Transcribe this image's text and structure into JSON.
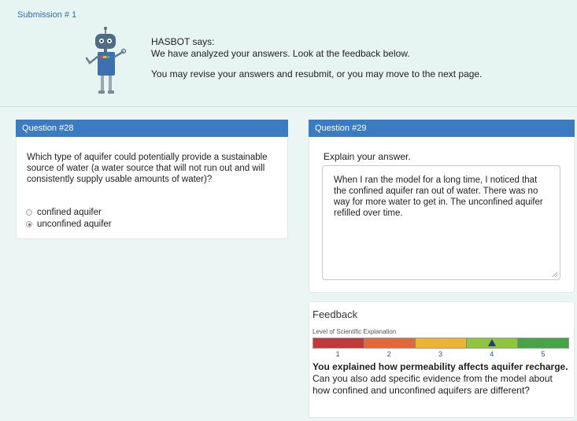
{
  "submission": {
    "label": "Submission # 1"
  },
  "bot": {
    "name": "HASBOT says:",
    "message_1": "We have analyzed your answers. Look at the feedback below.",
    "message_2": "You may revise your answers and resubmit, or you may move to the next page."
  },
  "question28": {
    "header": "Question #28",
    "prompt": "Which type of aquifer could potentially provide a sustainable source of water (a water source that will not run out and will consistently supply usable amounts of water)?",
    "options": [
      {
        "label": "confined aquifer",
        "selected": false
      },
      {
        "label": "unconfined aquifer",
        "selected": true
      }
    ]
  },
  "question29": {
    "header": "Question #29",
    "prompt": "Explain your answer.",
    "answer": "When I ran the model for a long time, I noticed that the confined aquifer ran out of water. There was no way for more water to get in. The unconfined aquifer refilled over time."
  },
  "feedback": {
    "title": "Feedback",
    "scale_label": "Level of Scientific Explanation",
    "levels": [
      "1",
      "2",
      "3",
      "4",
      "5"
    ],
    "level_colors": [
      "#c0393b",
      "#e0683a",
      "#f0b233",
      "#8fc43e",
      "#46a447"
    ],
    "current_level": 4,
    "bold_text": "You explained how permeability affects aquifer recharge.",
    "normal_text": " Can you also add specific evidence from the model about how confined and unconfined aquifers are different?"
  },
  "colors": {
    "header_blue": "#3a7bc2",
    "page_bg": "#eaf5f4"
  }
}
